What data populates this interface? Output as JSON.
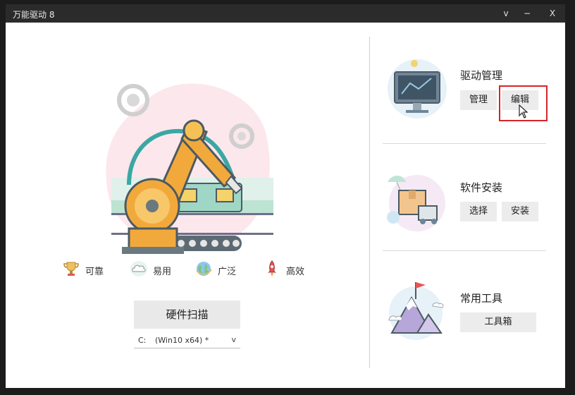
{
  "window": {
    "title": "万能驱动 8",
    "controls": {
      "menu": "v",
      "minimize": "−",
      "close": "X"
    }
  },
  "features": [
    {
      "label": "可靠",
      "icon": "trophy-icon"
    },
    {
      "label": "易用",
      "icon": "cloud-icon"
    },
    {
      "label": "广泛",
      "icon": "globe-icon"
    },
    {
      "label": "高效",
      "icon": "rocket-icon"
    }
  ],
  "scan": {
    "button_label": "硬件扫描",
    "drive_letter": "C:",
    "drive_value": "(Win10 x64) *",
    "chevron": "v"
  },
  "sections": {
    "driver_manage": {
      "title": "驱动管理",
      "buttons": [
        "管理",
        "编辑"
      ],
      "icon": "monitor-icon"
    },
    "software_install": {
      "title": "软件安装",
      "buttons": [
        "选择",
        "安装"
      ],
      "icon": "package-delivery-icon"
    },
    "common_tools": {
      "title": "常用工具",
      "buttons": [
        "工具箱"
      ],
      "icon": "mountain-flag-icon"
    }
  },
  "colors": {
    "accent_orange": "#f2a93b",
    "teal": "#3aa7a3",
    "highlight_red": "#d8232a"
  }
}
